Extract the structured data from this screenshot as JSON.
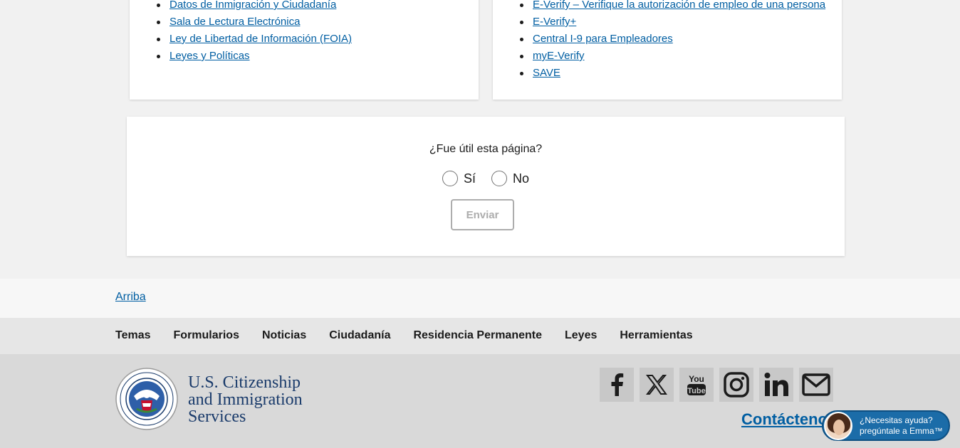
{
  "left_links": [
    "Datos de Inmigración y Ciudadanía",
    "Sala de Lectura Electrónica",
    "Ley de Libertad de Información (FOIA)",
    "Leyes y Políticas"
  ],
  "right_links": [
    "E-Verify – Verifique la autorización de empleo de una persona",
    "E-Verify+",
    "Central I-9 para Empleadores",
    "myE-Verify",
    "SAVE"
  ],
  "feedback": {
    "question": "¿Fue útil esta página?",
    "yes": "Sí",
    "no": "No",
    "submit": "Enviar"
  },
  "back_to_top": "Arriba",
  "footer_nav": [
    "Temas",
    "Formularios",
    "Noticias",
    "Ciudadanía",
    "Residencia Permanente",
    "Leyes",
    "Herramientas"
  ],
  "agency": {
    "line1": "U.S. Citizenship",
    "line2": "and Immigration",
    "line3": "Services"
  },
  "social_icons": [
    "facebook-icon",
    "x-icon",
    "youtube-icon",
    "instagram-icon",
    "linkedin-icon",
    "email-icon"
  ],
  "contact_label": "Contáctenos",
  "emma": {
    "line1": "¿Necesitas ayuda?",
    "line2": "pregúntale a Emma™"
  },
  "colors": {
    "link": "#005ea2",
    "agency_text": "#1a3b6b",
    "emma_bg": "#1b6ca8"
  }
}
